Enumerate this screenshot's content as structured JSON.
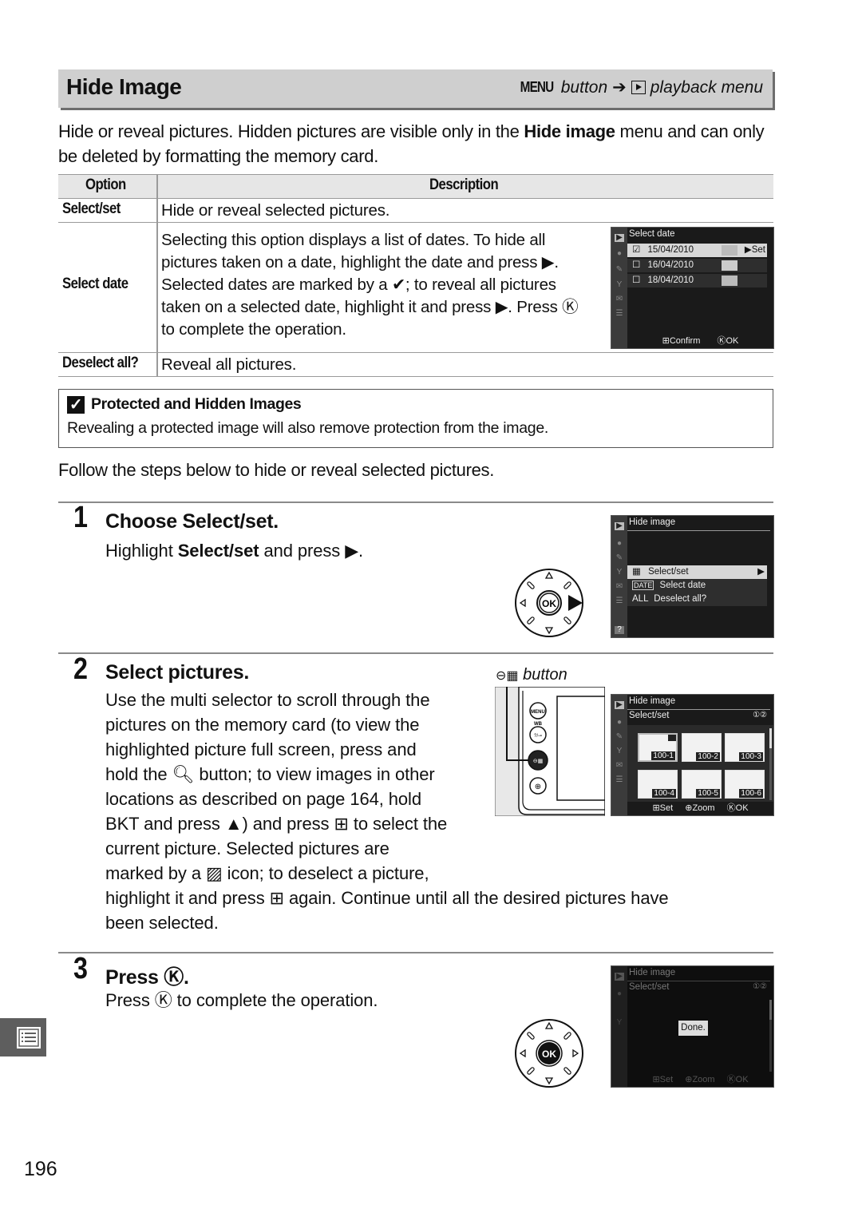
{
  "header": {
    "title": "Hide Image",
    "path_menu": "MENU",
    "path_button": "button",
    "path_arrow": "➔",
    "path_icon": "playback-icon",
    "path_menu_name": "playback menu"
  },
  "intro": {
    "part1": "Hide or reveal pictures.  Hidden pictures are visible only in the ",
    "bold": "Hide image",
    "part2": " menu and can only be deleted by formatting the memory card."
  },
  "table": {
    "headers": [
      "Option",
      "Description"
    ],
    "rows": [
      {
        "option": "Select/set",
        "description": "Hide or reveal selected pictures."
      },
      {
        "option": "Select date",
        "description": "Selecting this option displays a list of dates. To hide all pictures taken on a date, highlight the date and press ▶. Selected dates are marked by a ✔; to reveal all pictures taken on a selected date, highlight it and press ▶. Press ⓚ to complete the operation.",
        "description_lines": [
          "Selecting this option displays a list of dates. To hide all",
          "pictures taken on a date, highlight the date and press ▶.",
          "Selected dates are marked by a ✔; to reveal all pictures",
          "taken on a selected date, highlight it and press ▶. Press Ⓚ",
          "to complete the operation."
        ]
      },
      {
        "option": "Deselect all?",
        "description": "Reveal all pictures."
      }
    ]
  },
  "screen_select_date": {
    "title": "Select date",
    "items": [
      {
        "checked": "☑",
        "date": "15/04/2010",
        "action": "▶Set"
      },
      {
        "checked": "☐",
        "date": "16/04/2010",
        "action": ""
      },
      {
        "checked": "☐",
        "date": "18/04/2010",
        "action": ""
      }
    ],
    "footer_left": "Confirm",
    "footer_right": "OK"
  },
  "note": {
    "icon": "check-box-icon",
    "title": "Protected and Hidden Images",
    "body": "Revealing a protected image will also remove protection from the image."
  },
  "follow_text": "Follow the steps below to hide or reveal selected pictures.",
  "steps": [
    {
      "number": "1",
      "title_prefix": "Choose ",
      "title_bold": "Select/set.",
      "text_prefix": "Highlight ",
      "text_bold": "Select/set",
      "text_suffix": " and press ▶."
    },
    {
      "number": "2",
      "title": "Select pictures.",
      "button_label": "button",
      "lines": [
        "Use the multi selector to scroll through the",
        "pictures on the memory card (to view the",
        "highlighted picture full screen, press and",
        "hold the 🔍︎ button; to view images in other",
        "locations as described on page 164, hold",
        "BKT and press ▲) and press ⊞ to select the",
        "current picture.  Selected pictures are",
        "marked by a ▨ icon; to deselect a picture,",
        "highlight it and press ⊞ again. Continue until all the desired pictures have",
        "been selected."
      ]
    },
    {
      "number": "3",
      "title": "Press Ⓚ.",
      "text": "Press Ⓚ to complete the operation."
    }
  ],
  "screen_hide_image": {
    "title": "Hide image",
    "items": [
      {
        "icon": "▦",
        "label": "Select/set",
        "arrow": "▶"
      },
      {
        "icon": "DATE",
        "label": "Select date",
        "arrow": ""
      },
      {
        "icon": "ALL",
        "label": "Deselect all?",
        "arrow": ""
      }
    ],
    "help": "?"
  },
  "screen_select_set": {
    "title": "Hide image",
    "subtitle": "Select/set",
    "card": "①②",
    "thumbs": [
      "100-1",
      "100-2",
      "100-3",
      "100-4",
      "100-5",
      "100-6"
    ],
    "footer": [
      "Set",
      "Zoom",
      "OK"
    ]
  },
  "screen_done": {
    "title": "Hide image",
    "subtitle": "Select/set",
    "card": "①②",
    "message": "Done.",
    "footer": [
      "Set",
      "Zoom",
      "OK"
    ]
  },
  "camera_buttons": [
    "MENU",
    "WB",
    "⊸",
    "⊞",
    "🔍︎"
  ],
  "page_number": "196"
}
